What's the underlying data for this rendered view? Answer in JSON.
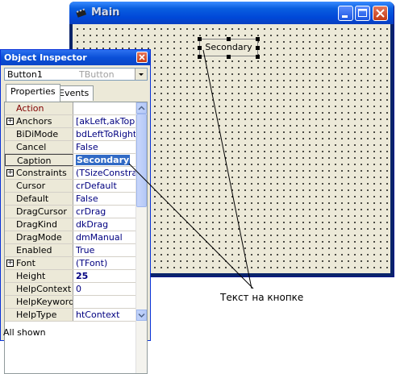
{
  "main_window": {
    "title": "Main",
    "design_button_caption": "Secondary"
  },
  "inspector": {
    "title": "Object Inspector",
    "component_name": "Button1",
    "component_class": "TButton",
    "tabs": [
      "Properties",
      "Events"
    ],
    "status": "All shown",
    "properties": [
      {
        "name": "Action",
        "value": "",
        "kind": "event"
      },
      {
        "name": "Anchors",
        "value": "[akLeft,akTop]",
        "expandable": true
      },
      {
        "name": "BiDiMode",
        "value": "bdLeftToRight"
      },
      {
        "name": "Cancel",
        "value": "False"
      },
      {
        "name": "Caption",
        "value": "Secondary",
        "selected": true
      },
      {
        "name": "Constraints",
        "value": "(TSizeConstrain",
        "expandable": true
      },
      {
        "name": "Cursor",
        "value": "crDefault"
      },
      {
        "name": "Default",
        "value": "False"
      },
      {
        "name": "DragCursor",
        "value": "crDrag"
      },
      {
        "name": "DragKind",
        "value": "dkDrag"
      },
      {
        "name": "DragMode",
        "value": "dmManual"
      },
      {
        "name": "Enabled",
        "value": "True"
      },
      {
        "name": "Font",
        "value": "(TFont)",
        "expandable": true
      },
      {
        "name": "Height",
        "value": "25",
        "bold": true
      },
      {
        "name": "HelpContext",
        "value": "0"
      },
      {
        "name": "HelpKeyword",
        "value": ""
      },
      {
        "name": "HelpType",
        "value": "htContext"
      }
    ]
  },
  "annotation": {
    "label": "Текст на кнопке"
  }
}
